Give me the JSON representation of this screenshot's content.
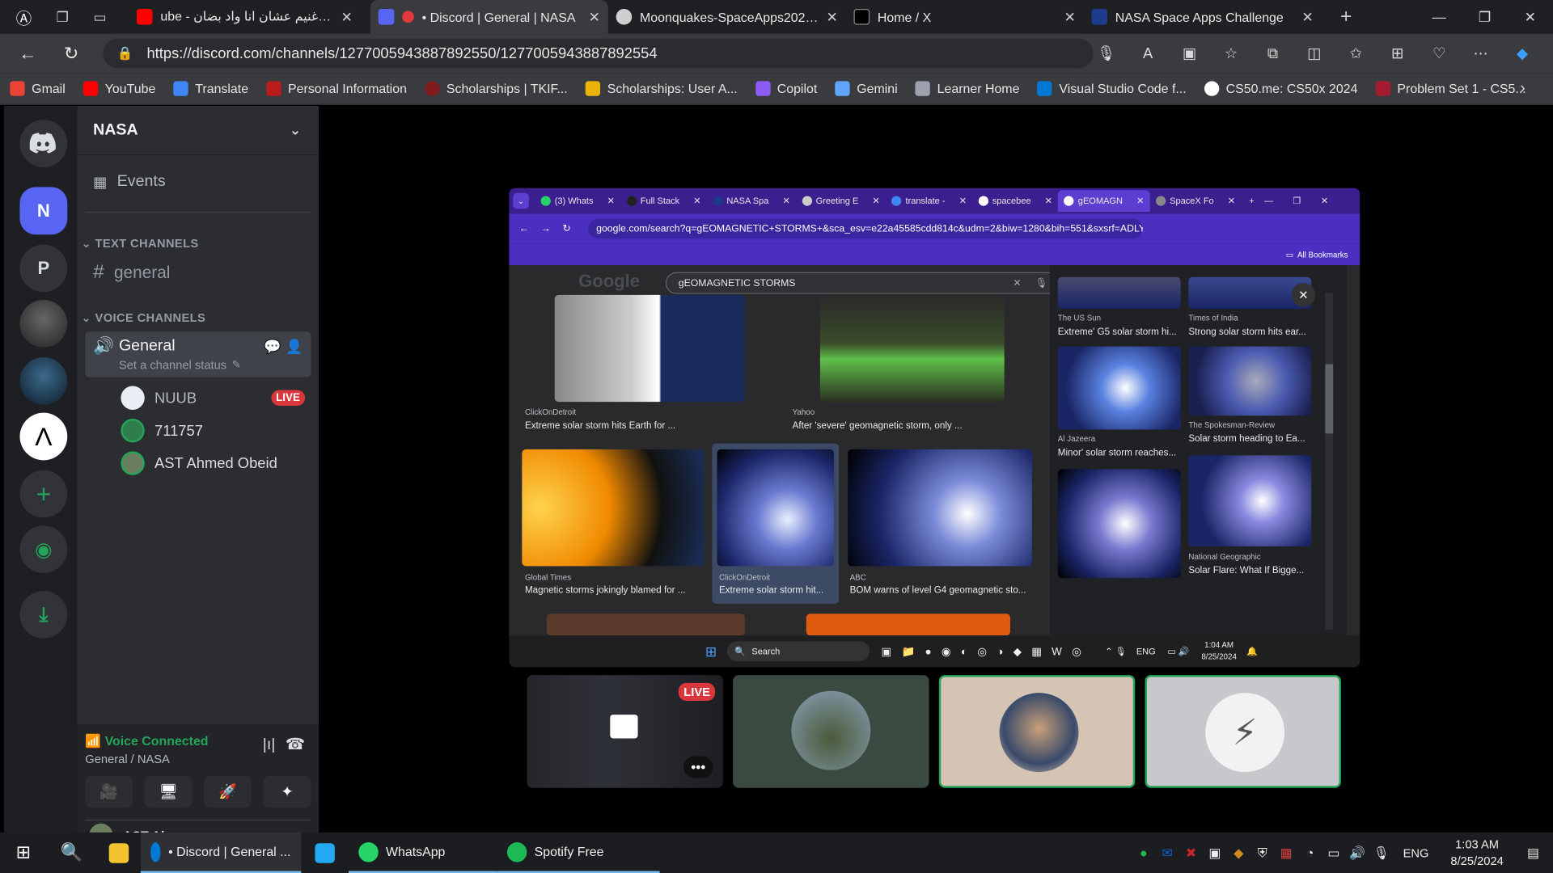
{
  "browser": {
    "tabs": [
      {
        "title": "ube - وائل غنيم عشان انا واد بضان",
        "favicon_color": "#ff0000",
        "active": false
      },
      {
        "title": "• Discord | General | NASA",
        "favicon_color": "#5865f2",
        "active": true
      },
      {
        "title": "Moonquakes-SpaceApps2023/c",
        "favicon_color": "#ffffff",
        "active": false
      },
      {
        "title": "Home / X",
        "favicon_color": "#000000",
        "active": false
      },
      {
        "title": "NASA Space Apps Challenge",
        "favicon_color": "#1e3a8a",
        "active": false
      }
    ],
    "new_tab": "+",
    "url": "https://discord.com/channels/1277005943887892550/1277005943887892554",
    "bookmarks": [
      {
        "label": "Gmail",
        "color": "#ea4335"
      },
      {
        "label": "YouTube",
        "color": "#ff0000"
      },
      {
        "label": "Translate",
        "color": "#4285f4"
      },
      {
        "label": "Personal Information",
        "color": "#b91c1c"
      },
      {
        "label": "Scholarships | TKIF...",
        "color": "#7f1d1d"
      },
      {
        "label": "Scholarships: User A...",
        "color": "#eab308"
      },
      {
        "label": "Copilot",
        "color": "#8b5cf6"
      },
      {
        "label": "Gemini",
        "color": "#60a5fa"
      },
      {
        "label": "Learner Home",
        "color": "#9ca3af"
      },
      {
        "label": "Visual Studio Code f...",
        "color": "#0078d4"
      },
      {
        "label": "CS50.me: CS50x 2024",
        "color": "#ffffff"
      },
      {
        "label": "Problem Set 1 - CS5...",
        "color": "#a51c30"
      }
    ]
  },
  "discord": {
    "server_name": "NASA",
    "guild_icons": [
      "N",
      "P"
    ],
    "events_label": "Events",
    "text_category": "TEXT CHANNELS",
    "text_channel": "general",
    "voice_category": "VOICE CHANNELS",
    "voice_channel": "General",
    "channel_status": "Set a channel status",
    "members": [
      {
        "name": "NUUB",
        "live": true
      },
      {
        "name": "711757",
        "live": false
      },
      {
        "name": "AST Ahmed Obeid",
        "live": false
      }
    ],
    "live_label": "LIVE",
    "voice_connected": "Voice Connected",
    "voice_location": "General / NASA",
    "partial_user": "AST Al"
  },
  "share": {
    "tabs": [
      "(3) Whats",
      "Full Stack",
      "NASA Spa",
      "Greeting E",
      "translate -",
      "spacebee",
      "gEOMAGN",
      "SpaceX Fo"
    ],
    "url": "google.com/search?q=gEOMAGNETIC+STORMS+&sca_esv=e22a45585cdd814c&udm=2&biw=1280&bih=551&sxsrf=ADLYWIJQ3lVrQ5kA_jpbn...",
    "all_bookmarks": "All Bookmarks",
    "google": "Google",
    "query": "gEOMAGNETIC STORMS",
    "results": [
      {
        "source": "ClickOnDetroit",
        "title": "Extreme solar storm hits Earth for ..."
      },
      {
        "source": "Yahoo",
        "title": "After 'severe' geomagnetic storm, only ..."
      },
      {
        "source": "The US Sun",
        "title": "Extreme' G5 solar storm hi..."
      },
      {
        "source": "Times of India",
        "title": "Strong solar storm hits ear..."
      },
      {
        "source": "Al Jazeera",
        "title": "Minor' solar storm reaches..."
      },
      {
        "source": "The Spokesman-Review",
        "title": "Solar storm heading to Ea..."
      },
      {
        "source": "Global Times",
        "title": "Magnetic storms jokingly blamed for ..."
      },
      {
        "source": "ClickOnDetroit",
        "title": "Extreme solar storm hit..."
      },
      {
        "source": "ABC",
        "title": "BOM warns of level G4 geomagnetic sto..."
      },
      {
        "source": "National Geographic",
        "title": "Solar Flare: What If Bigge..."
      }
    ],
    "taskbar_search": "Search",
    "lang": "ENG",
    "time": "1:04 AM",
    "date": "8/25/2024"
  },
  "tiles": {
    "live_label": "LIVE"
  },
  "taskbar": {
    "items": [
      {
        "label": "• Discord | General ...",
        "color": "#0078d4"
      },
      {
        "label": "",
        "color": "#23a9f2"
      },
      {
        "label": "WhatsApp",
        "color": "#25d366"
      },
      {
        "label": "Spotify Free",
        "color": "#1db954"
      }
    ],
    "lang": "ENG",
    "time": "1:03 AM",
    "date": "8/25/2024"
  }
}
